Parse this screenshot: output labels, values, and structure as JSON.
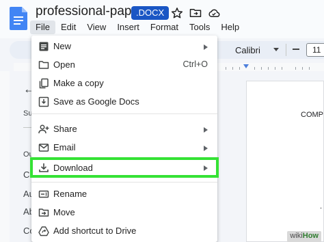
{
  "window": {
    "doc_title": "professional-paper",
    "file_badge": ".DOCX"
  },
  "menu_bar": {
    "items": [
      {
        "label": "File",
        "active": true
      },
      {
        "label": "Edit"
      },
      {
        "label": "View"
      },
      {
        "label": "Insert"
      },
      {
        "label": "Format"
      },
      {
        "label": "Tools"
      },
      {
        "label": "Help"
      }
    ]
  },
  "header_icons": [
    "star-icon",
    "move-to-folder-icon",
    "cloud-status-icon"
  ],
  "toolbar": {
    "font_name": "Calibri",
    "font_size": "11"
  },
  "sidebar": {
    "fragments": [
      "Su",
      "Ou",
      "Co",
      "Au",
      "Ab",
      "Co"
    ]
  },
  "document": {
    "visible_text": "COMP"
  },
  "file_menu": {
    "items": [
      {
        "label": "New",
        "icon": "new-document-icon",
        "submenu": true
      },
      {
        "label": "Open",
        "icon": "folder-open-icon",
        "shortcut": "Ctrl+O"
      },
      {
        "label": "Make a copy",
        "icon": "copy-icon"
      },
      {
        "label": "Save as Google Docs",
        "icon": "save-as-icon"
      },
      {
        "label": "Share",
        "icon": "person-add-icon",
        "submenu": true
      },
      {
        "label": "Email",
        "icon": "mail-icon",
        "submenu": true
      },
      {
        "label": "Download",
        "icon": "download-icon",
        "submenu": true,
        "highlighted": true
      },
      {
        "label": "Rename",
        "icon": "rename-icon"
      },
      {
        "label": "Move",
        "icon": "move-icon"
      },
      {
        "label": "Add shortcut to Drive",
        "icon": "drive-shortcut-icon"
      }
    ]
  },
  "colors": {
    "highlight": "#35e235",
    "badge": "#1a56c4",
    "docs_blue": "#4285f4"
  },
  "watermark": {
    "wiki": "wiki",
    "how": "How"
  }
}
